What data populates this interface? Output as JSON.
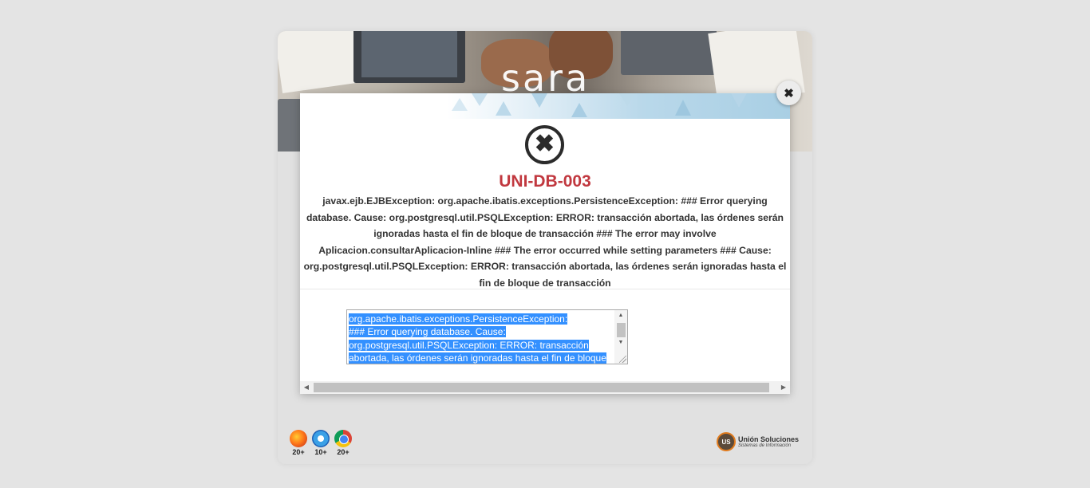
{
  "app": {
    "logo_text": "sara"
  },
  "browsers": [
    {
      "name": "firefox",
      "version": "20+"
    },
    {
      "name": "internet-explorer",
      "version": "10+"
    },
    {
      "name": "chrome",
      "version": "20+"
    }
  ],
  "company": {
    "seal_text": "US",
    "name": "Unión Soluciones",
    "tagline": "Sistemas de Información"
  },
  "dialog": {
    "close_symbol": "✖",
    "icon": "error-circle-x-icon",
    "icon_symbol": "✖",
    "code": "UNI-DB-003",
    "message": "javax.ejb.EJBException: org.apache.ibatis.exceptions.PersistenceException: ### Error querying database. Cause: org.postgresql.util.PSQLException: ERROR: transacción abortada, las órdenes serán ignoradas hasta el fin de bloque de transacción ### The error may involve Aplicacion.consultarAplicacion-Inline ### The error occurred while setting parameters ### Cause: org.postgresql.util.PSQLException: ERROR: transacción abortada, las órdenes serán ignoradas hasta el fin de bloque de transacción",
    "detail_lines": [
      "org.apache.ibatis.exceptions.PersistenceException:",
      "### Error querying database.  Cause:",
      "org.postgresql.util.PSQLException: ERROR: transacción",
      "abortada, las órdenes serán ignoradas hasta el fin de bloque"
    ]
  },
  "colors": {
    "error_code": "#c1383f",
    "selection": "#3390ff",
    "page_bg": "#e4e4e4"
  }
}
